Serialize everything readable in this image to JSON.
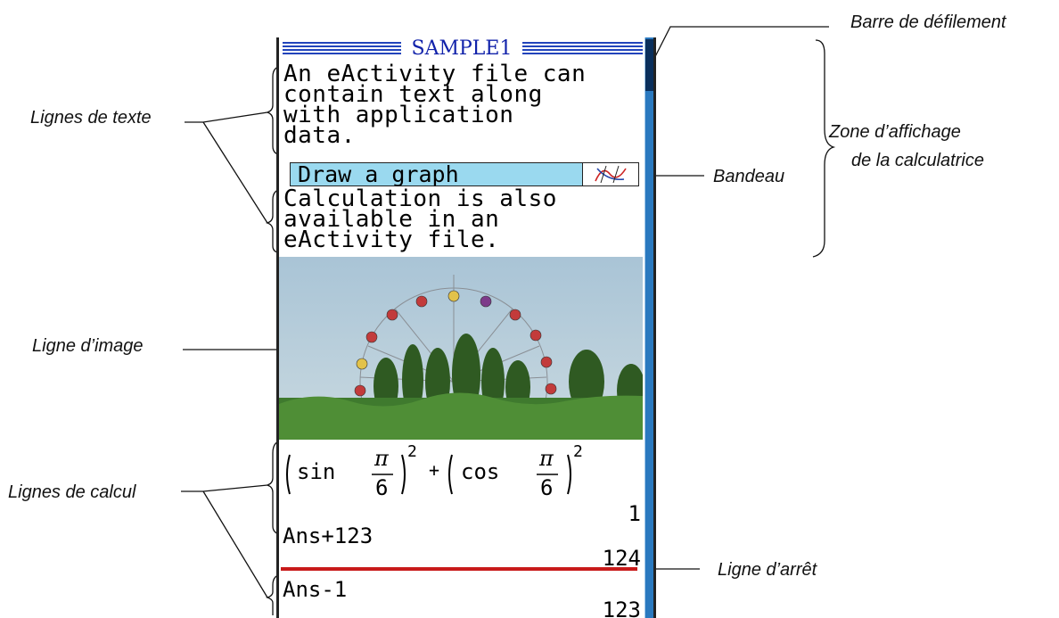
{
  "screen": {
    "title": "SAMPLE1",
    "text_block_1": [
      "An eActivity file can",
      "contain text along",
      "with application",
      "data."
    ],
    "strip_label": "Draw a graph",
    "strip_icon": "graph-icon",
    "text_block_2": [
      "Calculation is also",
      "available in an",
      "eActivity file."
    ],
    "image": "ferris-wheel-photo",
    "calc_1": {
      "fn1": "sin",
      "fn2": "cos",
      "num": "π",
      "den": "6",
      "exp": "2",
      "op": "+",
      "result": "1"
    },
    "calc_2": {
      "expr": "Ans+123",
      "result": "124"
    },
    "calc_3": {
      "expr": "Ans-1",
      "result": "123"
    }
  },
  "labels": {
    "scrollbar": "Barre de défilement",
    "display_area_1": "Zone d’affichage",
    "display_area_2": "de la calculatrice",
    "strip": "Bandeau",
    "text_lines": "Lignes de texte",
    "image_line": "Ligne d’image",
    "calc_lines": "Lignes de calcul",
    "stop_line": "Ligne d’arrêt"
  },
  "colors": {
    "title": "#1122aa",
    "strip_fill": "#9ad9ef",
    "scrollbar": "#2a79bf",
    "stop_line": "#c81a1a"
  }
}
